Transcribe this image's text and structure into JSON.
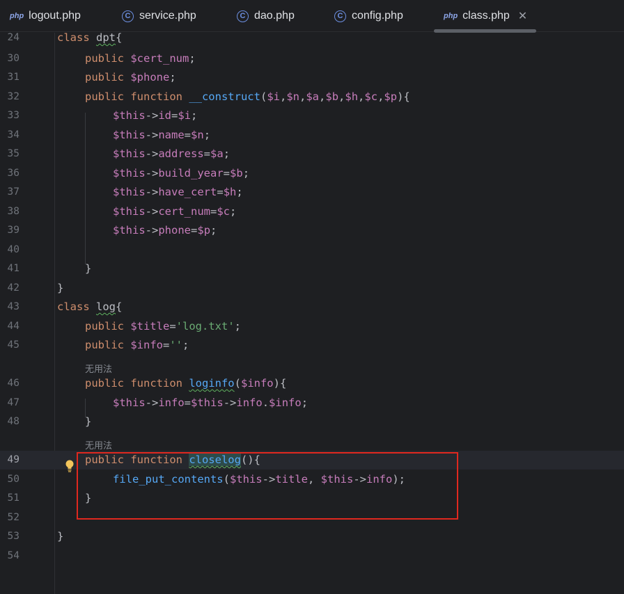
{
  "tabs": [
    {
      "label": "logout.php",
      "icon": "php-file-icon"
    },
    {
      "label": "service.php",
      "icon": "class-c-icon"
    },
    {
      "label": "dao.php",
      "icon": "class-c-icon"
    },
    {
      "label": "config.php",
      "icon": "class-c-icon"
    },
    {
      "label": "class.php",
      "icon": "php-file-icon",
      "active": true,
      "close": "✕"
    }
  ],
  "php_icon_text": "php",
  "class_icon_text": "C",
  "hints": {
    "unused_1": "无用法",
    "unused_2": "无用法"
  },
  "lines": [
    {
      "n": "24",
      "tokens": [
        [
          "kw",
          "class "
        ],
        [
          "plain",
          "dpt"
        ],
        [
          "plain",
          "{"
        ]
      ]
    },
    {
      "n": "30",
      "tokens": [
        [
          "kw",
          "public "
        ],
        [
          "var",
          "$cert_num"
        ],
        [
          "plain",
          ";"
        ]
      ]
    },
    {
      "n": "31",
      "tokens": [
        [
          "kw",
          "public "
        ],
        [
          "var",
          "$phone"
        ],
        [
          "plain",
          ";"
        ]
      ]
    },
    {
      "n": "32",
      "tokens": [
        [
          "kw",
          "public function "
        ],
        [
          "fn",
          "__construct"
        ],
        [
          "plain",
          "("
        ],
        [
          "var",
          "$i"
        ],
        [
          "plain",
          ","
        ],
        [
          "var",
          "$n"
        ],
        [
          "plain",
          ","
        ],
        [
          "var",
          "$a"
        ],
        [
          "plain",
          ","
        ],
        [
          "var",
          "$b"
        ],
        [
          "plain",
          ","
        ],
        [
          "var",
          "$h"
        ],
        [
          "plain",
          ","
        ],
        [
          "var",
          "$c"
        ],
        [
          "plain",
          ","
        ],
        [
          "var",
          "$p"
        ],
        [
          "plain",
          "){"
        ]
      ]
    },
    {
      "n": "33",
      "tokens": [
        [
          "var",
          "$this"
        ],
        [
          "plain",
          "->"
        ],
        [
          "prop",
          "id"
        ],
        [
          "plain",
          "="
        ],
        [
          "var",
          "$i"
        ],
        [
          "plain",
          ";"
        ]
      ]
    },
    {
      "n": "34",
      "tokens": [
        [
          "var",
          "$this"
        ],
        [
          "plain",
          "->"
        ],
        [
          "prop",
          "name"
        ],
        [
          "plain",
          "="
        ],
        [
          "var",
          "$n"
        ],
        [
          "plain",
          ";"
        ]
      ]
    },
    {
      "n": "35",
      "tokens": [
        [
          "var",
          "$this"
        ],
        [
          "plain",
          "->"
        ],
        [
          "prop",
          "address"
        ],
        [
          "plain",
          "="
        ],
        [
          "var",
          "$a"
        ],
        [
          "plain",
          ";"
        ]
      ]
    },
    {
      "n": "36",
      "tokens": [
        [
          "var",
          "$this"
        ],
        [
          "plain",
          "->"
        ],
        [
          "prop",
          "build_year"
        ],
        [
          "plain",
          "="
        ],
        [
          "var",
          "$b"
        ],
        [
          "plain",
          ";"
        ]
      ]
    },
    {
      "n": "37",
      "tokens": [
        [
          "var",
          "$this"
        ],
        [
          "plain",
          "->"
        ],
        [
          "prop",
          "have_cert"
        ],
        [
          "plain",
          "="
        ],
        [
          "var",
          "$h"
        ],
        [
          "plain",
          ";"
        ]
      ]
    },
    {
      "n": "38",
      "tokens": [
        [
          "var",
          "$this"
        ],
        [
          "plain",
          "->"
        ],
        [
          "prop",
          "cert_num"
        ],
        [
          "plain",
          "="
        ],
        [
          "var",
          "$c"
        ],
        [
          "plain",
          ";"
        ]
      ]
    },
    {
      "n": "39",
      "tokens": [
        [
          "var",
          "$this"
        ],
        [
          "plain",
          "->"
        ],
        [
          "prop",
          "phone"
        ],
        [
          "plain",
          "="
        ],
        [
          "var",
          "$p"
        ],
        [
          "plain",
          ";"
        ]
      ]
    },
    {
      "n": "40",
      "tokens": []
    },
    {
      "n": "41",
      "tokens": [
        [
          "plain",
          "}"
        ]
      ]
    },
    {
      "n": "42",
      "tokens": [
        [
          "plain",
          "}"
        ]
      ]
    },
    {
      "n": "43",
      "tokens": [
        [
          "kw",
          "class "
        ],
        [
          "plain",
          "log"
        ],
        [
          "plain",
          "{"
        ]
      ]
    },
    {
      "n": "44",
      "tokens": [
        [
          "kw",
          "public "
        ],
        [
          "var",
          "$title"
        ],
        [
          "plain",
          "="
        ],
        [
          "str",
          "'log.txt'"
        ],
        [
          "plain",
          ";"
        ]
      ]
    },
    {
      "n": "45",
      "tokens": [
        [
          "kw",
          "public "
        ],
        [
          "var",
          "$info"
        ],
        [
          "plain",
          "="
        ],
        [
          "str",
          "''"
        ],
        [
          "plain",
          ";"
        ]
      ]
    },
    {
      "n": "46",
      "tokens": [
        [
          "kw",
          "public function "
        ],
        [
          "fn",
          "loginfo"
        ],
        [
          "plain",
          "("
        ],
        [
          "var",
          "$info"
        ],
        [
          "plain",
          "){"
        ]
      ]
    },
    {
      "n": "47",
      "tokens": [
        [
          "var",
          "$this"
        ],
        [
          "plain",
          "->"
        ],
        [
          "prop",
          "info"
        ],
        [
          "plain",
          "="
        ],
        [
          "var",
          "$this"
        ],
        [
          "plain",
          "->"
        ],
        [
          "prop",
          "info"
        ],
        [
          "plain",
          "."
        ],
        [
          "var",
          "$info"
        ],
        [
          "plain",
          ";"
        ]
      ]
    },
    {
      "n": "48",
      "tokens": [
        [
          "plain",
          "}"
        ]
      ]
    },
    {
      "n": "49",
      "tokens": [
        [
          "kw",
          "public function "
        ],
        [
          "fn",
          "closelog"
        ],
        [
          "plain",
          "(){"
        ]
      ],
      "current": true
    },
    {
      "n": "50",
      "tokens": [
        [
          "fn",
          "file_put_contents"
        ],
        [
          "plain",
          "("
        ],
        [
          "var",
          "$this"
        ],
        [
          "plain",
          "->"
        ],
        [
          "prop",
          "title"
        ],
        [
          "plain",
          ", "
        ],
        [
          "var",
          "$this"
        ],
        [
          "plain",
          "->"
        ],
        [
          "prop",
          "info"
        ],
        [
          "plain",
          ");"
        ]
      ]
    },
    {
      "n": "51",
      "tokens": [
        [
          "plain",
          "}"
        ]
      ]
    },
    {
      "n": "52",
      "tokens": []
    },
    {
      "n": "53",
      "tokens": [
        [
          "plain",
          "}"
        ]
      ]
    },
    {
      "n": "54",
      "tokens": []
    }
  ]
}
